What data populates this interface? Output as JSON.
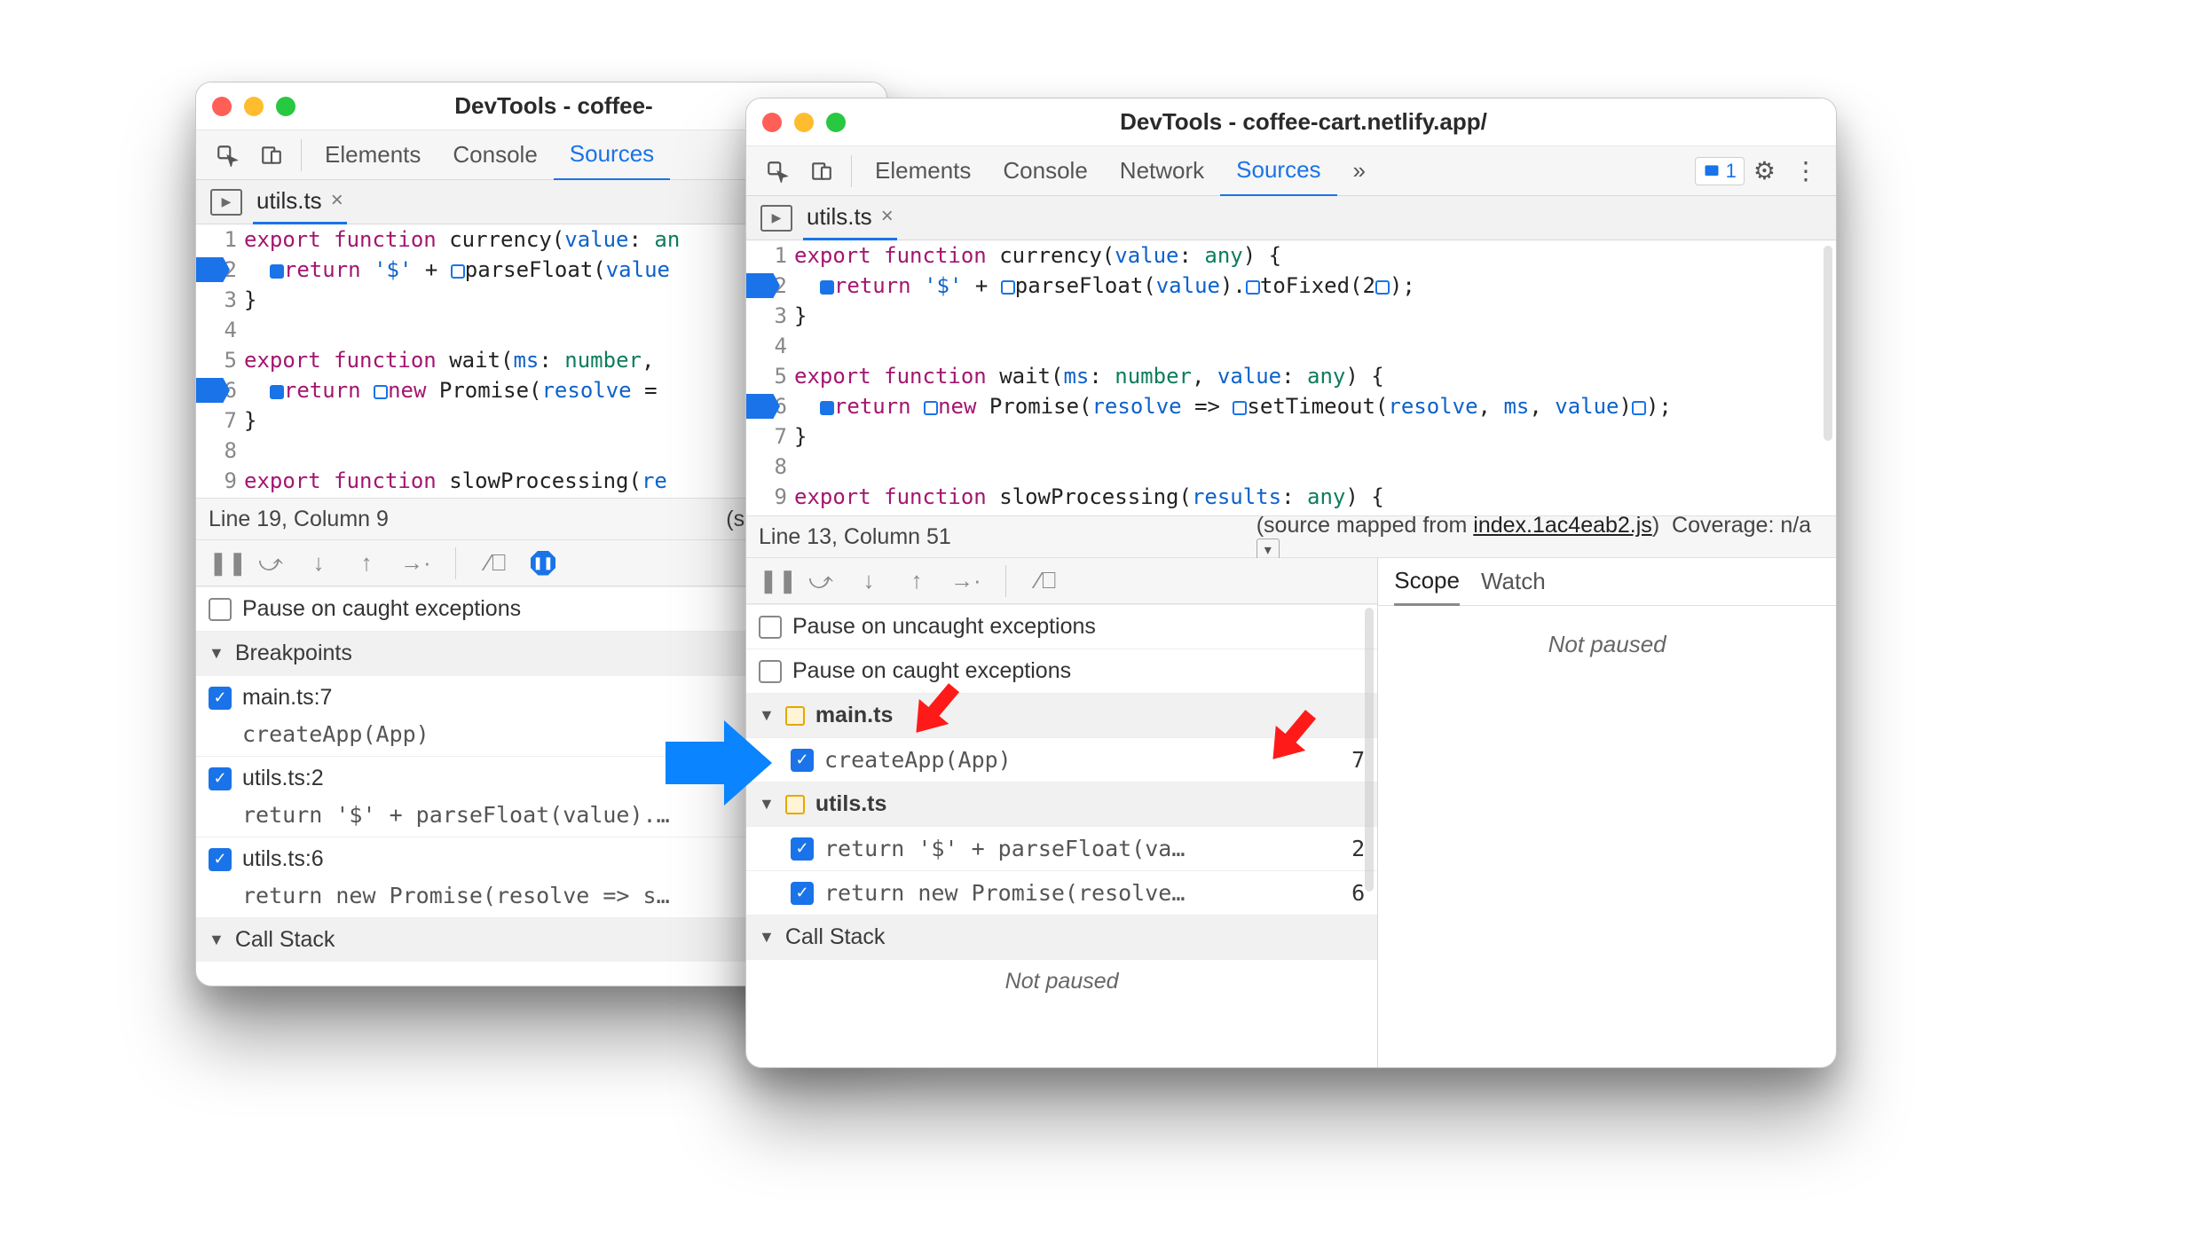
{
  "left_window": {
    "title": "DevTools - coffee-",
    "tabs": {
      "elements": "Elements",
      "console": "Console",
      "sources": "Sources"
    },
    "file_tab": {
      "name": "utils.ts"
    },
    "status": {
      "pos": "Line 19, Column 9",
      "mapped": "(source mappe"
    },
    "pause_caught": "Pause on caught exceptions",
    "section_breakpoints": "Breakpoints",
    "section_callstack": "Call Stack",
    "breakpoints": [
      {
        "label": "main.ts:7",
        "snippet": "createApp(App)"
      },
      {
        "label": "utils.ts:2",
        "snippet": "return '$' + parseFloat(value).…"
      },
      {
        "label": "utils.ts:6",
        "snippet": "return new Promise(resolve => s…"
      }
    ],
    "code": {
      "l1": "export function currency(value: an",
      "l2": "return '$' + parseFloat(value",
      "l3": "}",
      "l5": "export function wait(ms: number,",
      "l6": "return new Promise(resolve =",
      "l7": "}",
      "l9": "export function slowProcessing(re"
    }
  },
  "right_window": {
    "title": "DevTools - coffee-cart.netlify.app/",
    "tabs": {
      "elements": "Elements",
      "console": "Console",
      "network": "Network",
      "sources": "Sources",
      "more": "»"
    },
    "issues": "1",
    "file_tab": {
      "name": "utils.ts"
    },
    "status": {
      "pos": "Line 13, Column 51",
      "mapped_prefix": "(source mapped from ",
      "mapped_link": "index.1ac4eab2.js",
      "mapped_suffix": ")",
      "coverage": "Coverage: n/a"
    },
    "pause_uncaught": "Pause on uncaught exceptions",
    "pause_caught": "Pause on caught exceptions",
    "section_callstack": "Call Stack",
    "not_paused": "Not paused",
    "scope_tab": "Scope",
    "watch_tab": "Watch",
    "group1": {
      "file": "main.ts",
      "items": [
        {
          "snippet": "createApp(App)",
          "line": "7"
        }
      ]
    },
    "group2": {
      "file": "utils.ts",
      "items": [
        {
          "snippet": "return '$' + parseFloat(va…",
          "line": "2"
        },
        {
          "snippet": "return new Promise(resolve…",
          "line": "6"
        }
      ]
    },
    "code": {
      "l1": "export function currency(value: any) {",
      "l2a": "return '$' + ",
      "l2b": "parseFloat(value).",
      "l2c": "toFixed(2",
      "l2d": ");",
      "l3": "}",
      "l5": "export function wait(ms: number, value: any) {",
      "l6a": "return ",
      "l6b": "new Promise(resolve => ",
      "l6c": "setTimeout(resolve, ms, value)",
      "l6d": ");",
      "l7": "}",
      "l9": "export function slowProcessing(results: any) {"
    }
  }
}
